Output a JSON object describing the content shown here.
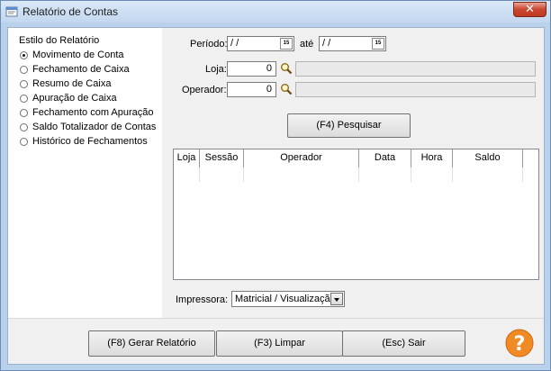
{
  "window": {
    "title": "Relatório de Contas"
  },
  "style_group": {
    "title": "Estilo do Relatório",
    "options": [
      {
        "label": "Movimento de Conta",
        "selected": true
      },
      {
        "label": "Fechamento de Caixa",
        "selected": false
      },
      {
        "label": "Resumo de Caixa",
        "selected": false
      },
      {
        "label": "Apuração de Caixa",
        "selected": false
      },
      {
        "label": "Fechamento com Apuração",
        "selected": false
      },
      {
        "label": "Saldo Totalizador de Contas",
        "selected": false
      },
      {
        "label": "Histórico de Fechamentos",
        "selected": false
      }
    ]
  },
  "filters": {
    "periodo_label": "Período:",
    "ate_label": "até",
    "date_from": " /  /",
    "date_to": " /  /",
    "calendar_text": "15",
    "loja_label": "Loja:",
    "loja_value": "0",
    "loja_desc": "",
    "operador_label": "Operador:",
    "operador_value": "0",
    "operador_desc": ""
  },
  "search_button": "(F4) Pesquisar",
  "grid": {
    "columns": [
      "Loja",
      "Sessão",
      "Operador",
      "Data",
      "Hora",
      "Saldo"
    ],
    "rows": []
  },
  "printer": {
    "label": "Impressora:",
    "selected": "Matricial / Visualização"
  },
  "footer": {
    "generate": "(F8) Gerar Relatório",
    "clear": "(F3) Limpar",
    "exit": "(Esc) Sair"
  },
  "colors": {
    "window_frame": "#b9d1ea",
    "help_orange": "#f08a24",
    "close_red": "#c9452f"
  }
}
